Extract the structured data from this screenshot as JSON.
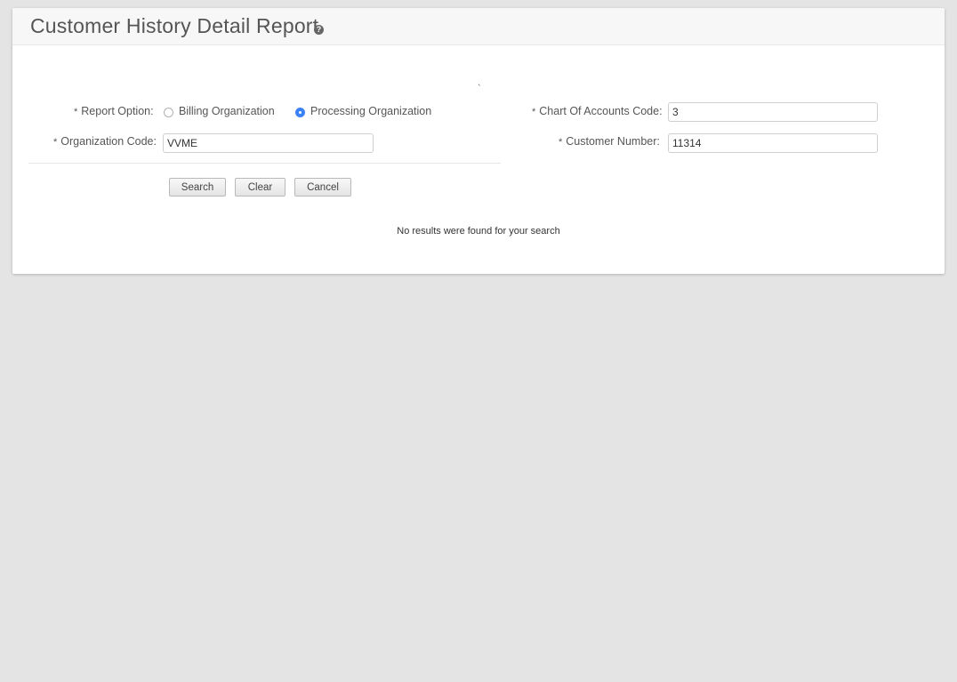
{
  "page": {
    "title": "Customer History Detail Report",
    "help_icon_glyph": "?",
    "stray_mark": "`"
  },
  "form": {
    "required_marker": "*",
    "report_option": {
      "label": "Report Option:",
      "options": [
        {
          "label": "Billing Organization",
          "selected": false
        },
        {
          "label": "Processing Organization",
          "selected": true
        }
      ]
    },
    "organization_code": {
      "label": "Organization Code:",
      "value": "VVME"
    },
    "chart_of_accounts_code": {
      "label": "Chart Of Accounts Code:",
      "value": "3"
    },
    "customer_number": {
      "label": "Customer Number:",
      "value": "11314"
    }
  },
  "actions": {
    "search_label": "Search",
    "clear_label": "Clear",
    "cancel_label": "Cancel"
  },
  "results": {
    "message": "No results were found for your search"
  },
  "colors": {
    "background": "#e4e4e4",
    "panel": "#ffffff",
    "header": "#f7f7f7",
    "radio_selected": "#3b82f6",
    "text": "#555555"
  },
  "icons": {
    "help": "help-icon",
    "radio_unchecked": "radio-unchecked-icon",
    "radio_checked": "radio-checked-icon"
  }
}
